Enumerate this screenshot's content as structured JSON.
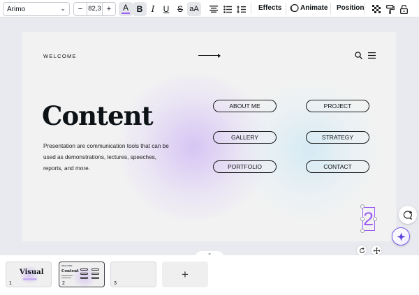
{
  "toolbar": {
    "font_name": "Arimo",
    "font_size": "82,3",
    "decrease_label": "−",
    "increase_label": "+",
    "text_color_glyph": "A",
    "bold_glyph": "B",
    "italic_glyph": "I",
    "underline_glyph": "U",
    "strike_glyph": "S",
    "case_glyph": "aA",
    "effects_label": "Effects",
    "animate_label": "Animate",
    "position_label": "Position",
    "text_color": "#9b5df5"
  },
  "slide": {
    "welcome": "WELCOME",
    "heading": "Content",
    "body": "Presentation are communication tools that can be used as demonstrations, lectures, speeches, reports, and more.",
    "buttons": [
      "ABOUT ME",
      "PROJECT",
      "GALLERY",
      "STRATEGY",
      "PORTFOLIO",
      "CONTACT"
    ],
    "page_number": "2",
    "accent": "#9b5df5"
  },
  "pages": {
    "thumb1_title": "Visual",
    "thumb2_title": "Content",
    "labels": [
      "1",
      "2",
      "3"
    ],
    "add_label": "+"
  }
}
